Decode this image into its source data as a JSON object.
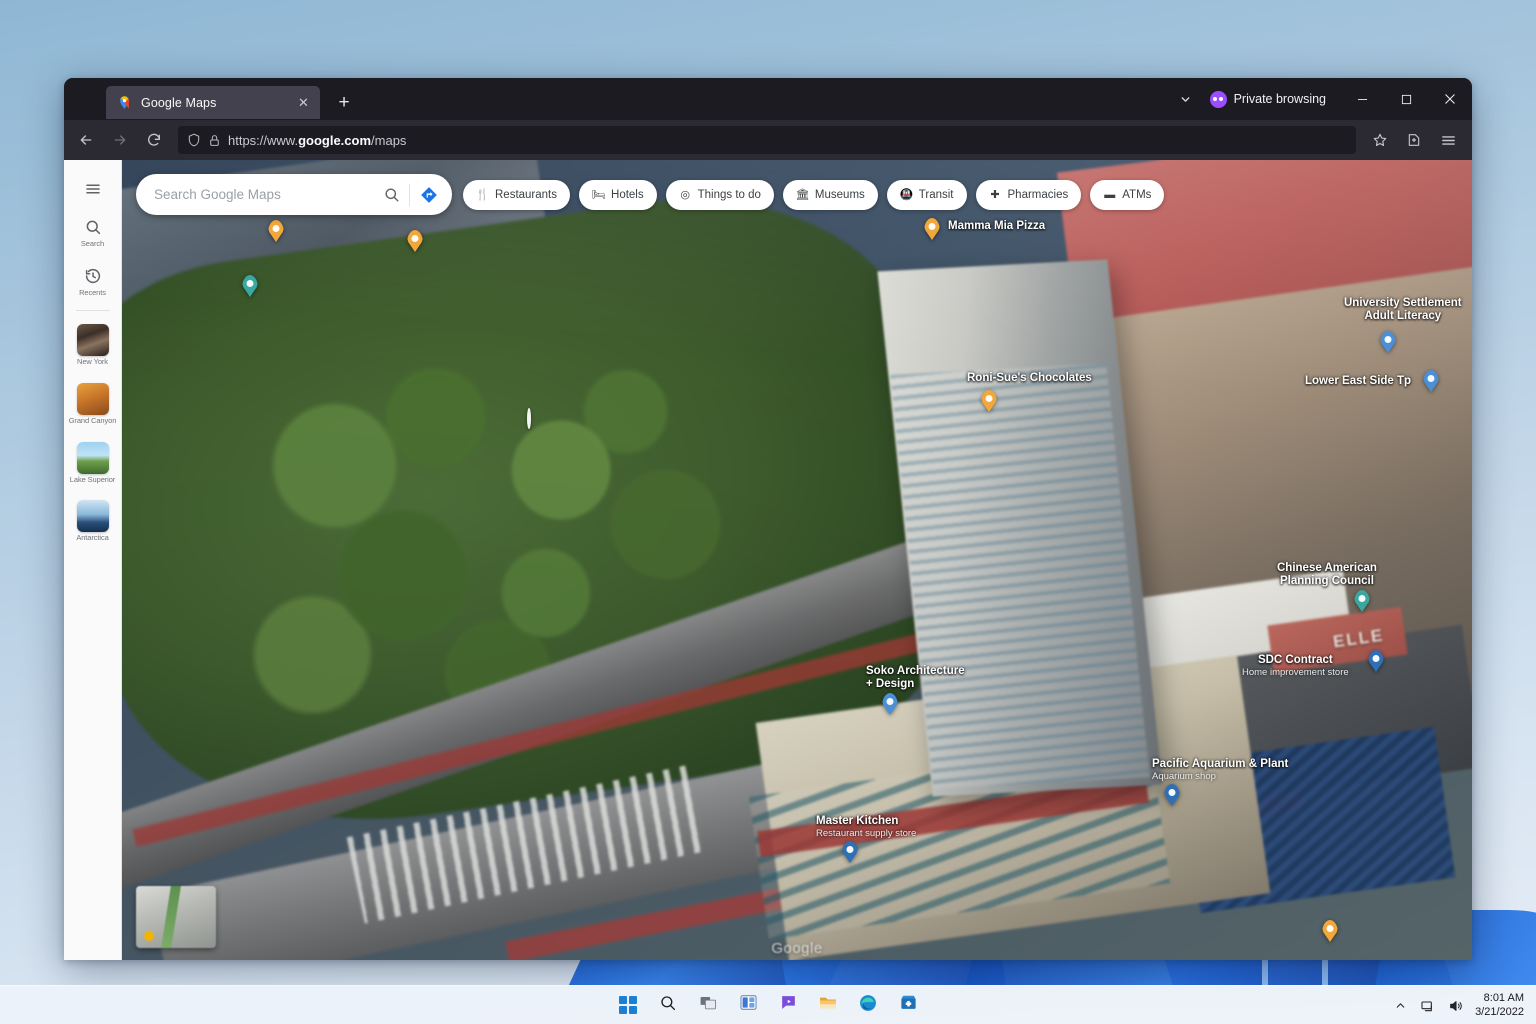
{
  "browser": {
    "name": "Firefox",
    "tab": {
      "title": "Google Maps",
      "favicon": "google-maps-favicon",
      "close_label": "✕"
    },
    "newtab_label": "+",
    "private_badge": {
      "label": "Private browsing",
      "icon": "mask-icon"
    },
    "window_controls": {
      "minimize": "—",
      "maximize": "▢",
      "close": "✕",
      "list_all_tabs": "⌄"
    },
    "nav": {
      "back": "←",
      "forward": "→",
      "reload": "⟳"
    },
    "url": {
      "prefix": "https://www.",
      "domain": "google.com",
      "suffix": "/maps",
      "shield_icon": "shield-icon",
      "lock_icon": "lock-icon"
    },
    "toolbar_right": {
      "bookmark": "star-icon",
      "extensions": "extensions-icon",
      "menu": "hamburger-icon"
    }
  },
  "maps": {
    "search": {
      "placeholder": "Search Google Maps",
      "value": "",
      "search_icon": "search-icon",
      "directions_icon": "directions-icon"
    },
    "chips": [
      {
        "label": "Restaurants",
        "icon": "restaurant-icon"
      },
      {
        "label": "Hotels",
        "icon": "hotel-icon"
      },
      {
        "label": "Things to do",
        "icon": "ticket-icon"
      },
      {
        "label": "Museums",
        "icon": "museum-icon"
      },
      {
        "label": "Transit",
        "icon": "transit-icon"
      },
      {
        "label": "Pharmacies",
        "icon": "pharmacy-icon"
      },
      {
        "label": "ATMs",
        "icon": "atm-icon"
      }
    ],
    "rail": [
      {
        "label": "",
        "icon": "hamburger-icon",
        "kind": "glyph"
      },
      {
        "label": "Search",
        "icon": "search-icon",
        "kind": "glyph"
      },
      {
        "label": "Recents",
        "icon": "history-icon",
        "kind": "glyph"
      },
      {
        "label": "New York",
        "icon": "thumbnail-nyc",
        "kind": "thumb"
      },
      {
        "label": "Grand Canyon",
        "icon": "thumbnail-grand-canyon",
        "kind": "thumb"
      },
      {
        "label": "Lake Superior",
        "icon": "thumbnail-lake-superior",
        "kind": "thumb"
      },
      {
        "label": "Antarctica",
        "icon": "thumbnail-antarctica",
        "kind": "thumb"
      }
    ],
    "pois": [
      {
        "name": "Roni-Sue's Chocolates",
        "sub": "",
        "pin": "org"
      },
      {
        "name": "Mamma Mia Pizza",
        "sub": "",
        "pin": "org"
      },
      {
        "name": "University Settlement",
        "sub": "Adult Literacy",
        "pin": "blue"
      },
      {
        "name": "Lower East Side Tp",
        "sub": "",
        "pin": "blue"
      },
      {
        "name": "Chinese American",
        "sub": "Planning Council",
        "pin": "teal"
      },
      {
        "name": "SDC Contract",
        "sub": "Home improvement store",
        "pin": "navy"
      },
      {
        "name": "Pacific Aquarium & Plant",
        "sub": "Aquarium shop",
        "pin": "navy"
      },
      {
        "name": "Soko Architecture",
        "sub": "+ Design",
        "pin": "blue"
      },
      {
        "name": "Master Kitchen",
        "sub": "Restaurant supply store",
        "pin": "navy"
      }
    ],
    "building_sign": "ELLE",
    "watermark": "Google",
    "street_view_label": "street-view-thumbnail"
  },
  "taskbar": {
    "icons": [
      {
        "name": "start-button",
        "label": "Start"
      },
      {
        "name": "search-button",
        "label": "Search"
      },
      {
        "name": "task-view-button",
        "label": "Task View"
      },
      {
        "name": "widgets-button",
        "label": "Widgets"
      },
      {
        "name": "chat-button",
        "label": "Chat"
      },
      {
        "name": "file-explorer-button",
        "label": "File Explorer"
      },
      {
        "name": "edge-button",
        "label": "Microsoft Edge"
      },
      {
        "name": "store-button",
        "label": "Microsoft Store"
      }
    ],
    "tray": {
      "overflow": "⌃",
      "network": "network-icon",
      "volume": "volume-icon"
    },
    "clock": {
      "time": "8:01 AM",
      "date": "3/21/2022"
    }
  },
  "colors": {
    "firefox_chrome": "#2b2a33",
    "firefox_tabstrip": "#1c1b22",
    "private_purple": "#9b4dff",
    "google_blue": "#1a73e8",
    "taskbar": "#eef3fa"
  }
}
